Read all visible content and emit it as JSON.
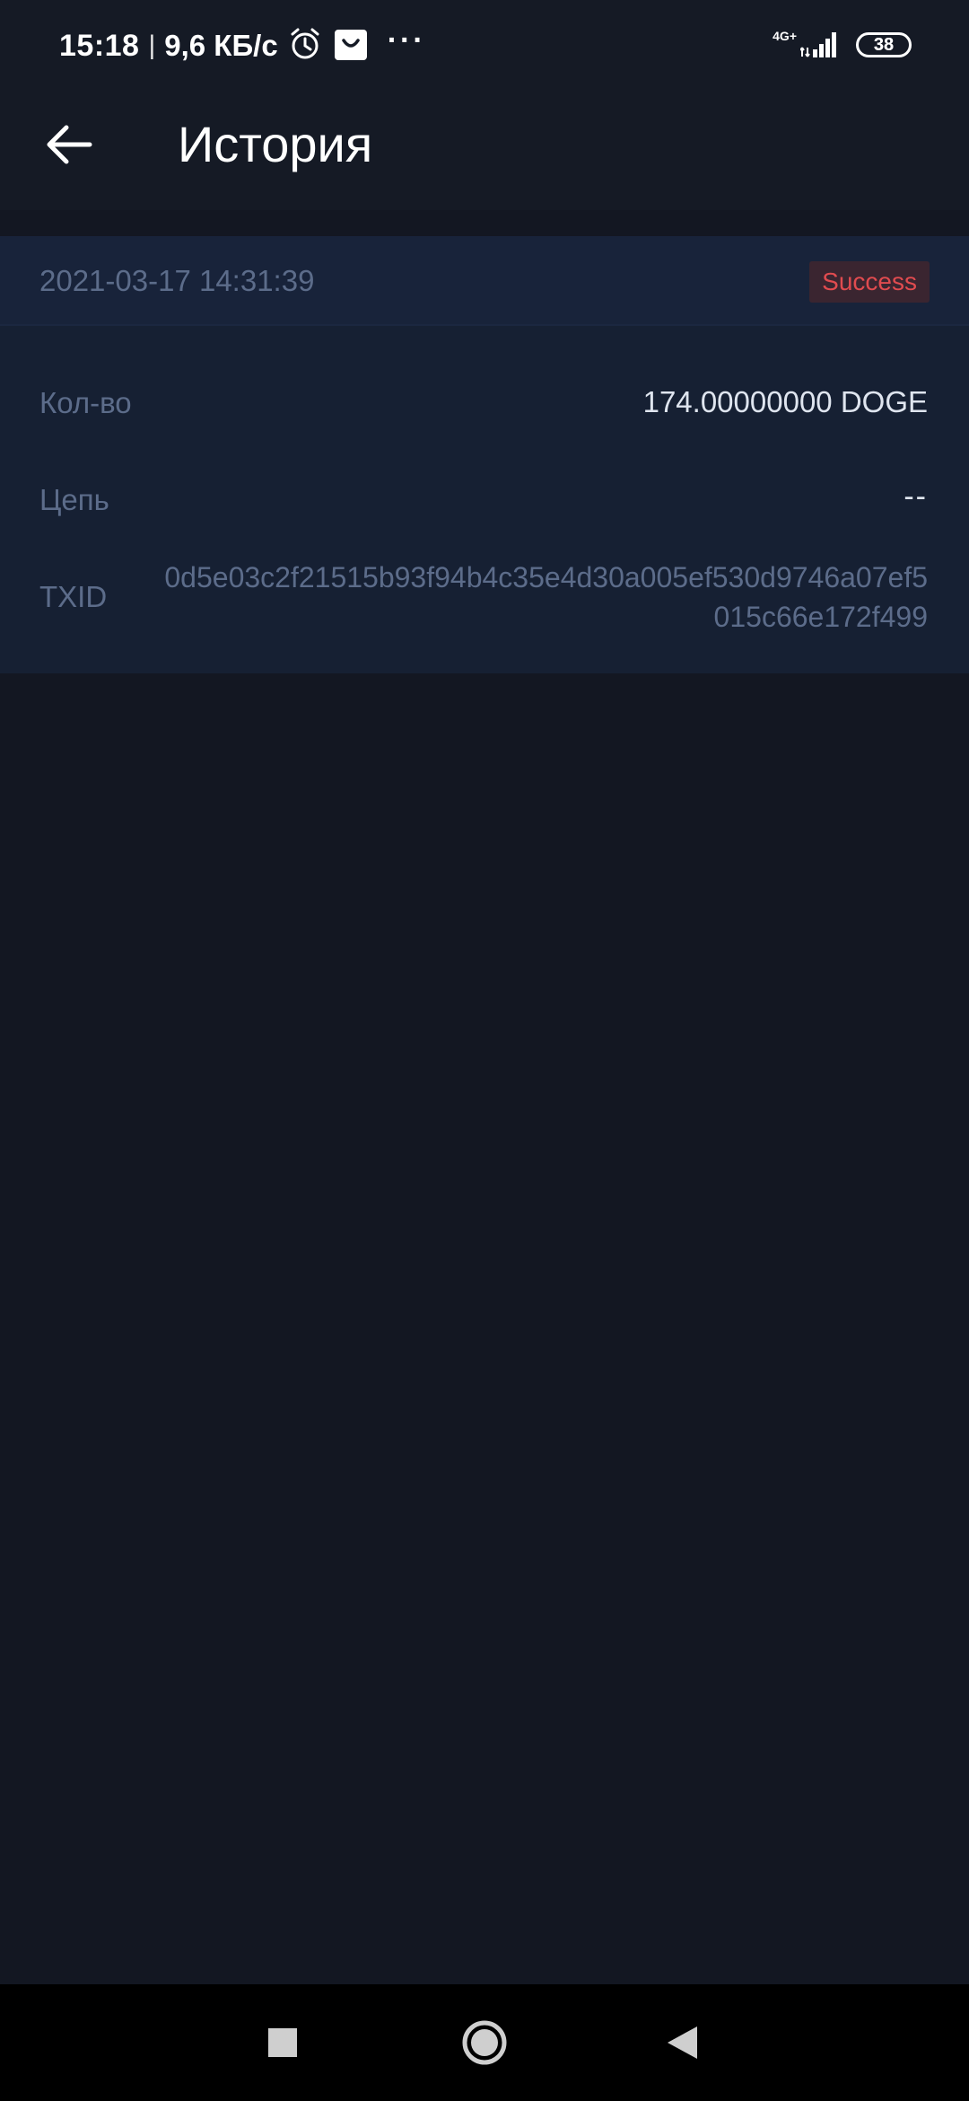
{
  "status_bar": {
    "time": "15:18",
    "separator": "|",
    "speed": "9,6 КБ/с",
    "dots": "···",
    "network": "4G+",
    "battery": "38",
    "icons": [
      "alarm-icon",
      "shop-icon",
      "signal-icon",
      "battery-icon"
    ]
  },
  "header": {
    "title": "История",
    "back_icon": "arrow-left-icon"
  },
  "record": {
    "datetime": "2021-03-17 14:31:39",
    "status": "Success",
    "rows": [
      {
        "label": "Кол-во",
        "value": "174.00000000 DOGE"
      },
      {
        "label": "Цепь",
        "value": "--"
      },
      {
        "label": "TXID",
        "value": "0d5e03c2f21515b93f94b4c35e4d30a005ef530d9746a07ef5015c66e172f499"
      }
    ]
  },
  "nav_bar": {
    "icons": [
      "recent-apps-icon",
      "home-icon",
      "back-icon"
    ]
  },
  "colors": {
    "background": "#131722",
    "header": "#151a25",
    "card": "#162033",
    "label": "#5c6c8a",
    "value": "#dfe5ef",
    "success_text": "#e04b4f",
    "success_bg": "#3a2530"
  }
}
